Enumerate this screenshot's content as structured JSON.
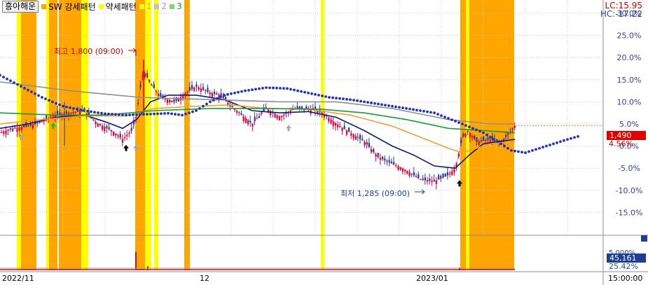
{
  "legend": {
    "title": "흥아해운",
    "strong_label": "SW 강세패턴",
    "weak_label": "약세패턴",
    "numbers": [
      "1",
      "2",
      "3"
    ]
  },
  "header_right": {
    "lc": "LC:15.95",
    "hc": "HC:-17.22"
  },
  "current": {
    "price": "1,490",
    "change_pct": "4.56%"
  },
  "annotations": {
    "high": "최고 1,800 (09:00)",
    "low": "최저 1,285 (09:00)"
  },
  "volume_panel": {
    "value": "45,161",
    "pct": "25.42%",
    "top_label": "5.000%"
  },
  "x_axis": {
    "labels": [
      "2022/11",
      "12",
      "2023/01"
    ],
    "corner_time": "15:00:00"
  },
  "colors": {
    "strong_band": "#ffa500",
    "weak_band": "#ffff00",
    "candle_up": "#e0003a",
    "candle_down": "#1f3fa8",
    "ma_dark_blue": "#0d1a7a",
    "ma_orange": "#f0a030",
    "ma_green": "#1a9a3a",
    "ma_gray": "#909090",
    "projection_dots": "#2030c0",
    "axis_text": "#3b3b9b"
  },
  "chart_data": {
    "type": "line",
    "title": "",
    "y_axis_unit": "%",
    "y_ticks": [
      "30.0%",
      "25.0%",
      "20.0%",
      "15.0%",
      "10.0%",
      "5.0%",
      "0.0%",
      "-5.0%",
      "-10.0%",
      "-15.0%"
    ],
    "ylim": [
      -20,
      33
    ],
    "x_range": [
      0,
      860
    ],
    "x_ticks": [
      {
        "label": "2022/11",
        "x": 0
      },
      {
        "label": "12",
        "x": 283
      },
      {
        "label": "2023/01",
        "x": 592
      }
    ],
    "grid": true,
    "series": [
      {
        "kind": "close",
        "values": [
          [
            0,
            3.0
          ],
          [
            20,
            4.0
          ],
          [
            40,
            4.5
          ],
          [
            60,
            5.5
          ],
          [
            80,
            7.0
          ],
          [
            100,
            7.5
          ],
          [
            120,
            8.0
          ],
          [
            140,
            5.0
          ],
          [
            160,
            3.5
          ],
          [
            175,
            1.5
          ],
          [
            188,
            3.5
          ],
          [
            195,
            7.0
          ],
          [
            200,
            13.0
          ],
          [
            205,
            17.0
          ],
          [
            215,
            14.0
          ],
          [
            230,
            11.0
          ],
          [
            250,
            10.0
          ],
          [
            265,
            12.0
          ],
          [
            280,
            13.5
          ],
          [
            300,
            12.0
          ],
          [
            315,
            11.5
          ],
          [
            330,
            9.0
          ],
          [
            345,
            7.0
          ],
          [
            360,
            5.0
          ],
          [
            380,
            8.5
          ],
          [
            400,
            6.5
          ],
          [
            420,
            8.5
          ],
          [
            440,
            8.5
          ],
          [
            460,
            7.5
          ],
          [
            480,
            5.0
          ],
          [
            500,
            3.0
          ],
          [
            520,
            1.0
          ],
          [
            540,
            -2.5
          ],
          [
            560,
            -4.0
          ],
          [
            580,
            -5.5
          ],
          [
            600,
            -7.5
          ],
          [
            620,
            -8.0
          ],
          [
            640,
            -6.5
          ],
          [
            650,
            -5.0
          ],
          [
            660,
            2.0
          ],
          [
            668,
            3.5
          ],
          [
            680,
            1.0
          ],
          [
            700,
            1.5
          ],
          [
            715,
            0.8
          ],
          [
            730,
            3.5
          ],
          [
            735,
            4.56
          ]
        ]
      },
      {
        "kind": "ma",
        "color": "ma_dark_blue",
        "values": [
          [
            0,
            4.0
          ],
          [
            40,
            5.0
          ],
          [
            80,
            6.5
          ],
          [
            120,
            7.0
          ],
          [
            150,
            5.5
          ],
          [
            175,
            4.0
          ],
          [
            195,
            6.0
          ],
          [
            215,
            10.0
          ],
          [
            240,
            11.5
          ],
          [
            280,
            11.5
          ],
          [
            320,
            10.5
          ],
          [
            360,
            8.0
          ],
          [
            400,
            7.5
          ],
          [
            440,
            7.8
          ],
          [
            480,
            6.5
          ],
          [
            520,
            3.5
          ],
          [
            560,
            0.0
          ],
          [
            590,
            -2.0
          ],
          [
            620,
            -4.5
          ],
          [
            650,
            -5.0
          ],
          [
            670,
            -2.0
          ],
          [
            690,
            0.5
          ],
          [
            710,
            1.0
          ],
          [
            735,
            1.5
          ]
        ]
      },
      {
        "kind": "ma",
        "color": "ma_orange",
        "values": [
          [
            0,
            5.0
          ],
          [
            60,
            6.0
          ],
          [
            120,
            6.8
          ],
          [
            180,
            6.8
          ],
          [
            220,
            8.5
          ],
          [
            280,
            9.0
          ],
          [
            330,
            9.3
          ],
          [
            380,
            8.5
          ],
          [
            440,
            8.3
          ],
          [
            500,
            7.0
          ],
          [
            560,
            4.5
          ],
          [
            600,
            2.0
          ],
          [
            640,
            -0.5
          ],
          [
            660,
            -1.5
          ],
          [
            700,
            0.5
          ],
          [
            735,
            1.0
          ]
        ]
      },
      {
        "kind": "ma",
        "color": "ma_green",
        "values": [
          [
            0,
            7.5
          ],
          [
            80,
            7.0
          ],
          [
            150,
            7.0
          ],
          [
            220,
            8.0
          ],
          [
            300,
            8.5
          ],
          [
            380,
            8.5
          ],
          [
            460,
            8.3
          ],
          [
            520,
            7.5
          ],
          [
            580,
            6.0
          ],
          [
            640,
            4.0
          ],
          [
            690,
            3.5
          ],
          [
            735,
            3.0
          ]
        ]
      },
      {
        "kind": "ma",
        "color": "ma_gray",
        "values": [
          [
            0,
            14.5
          ],
          [
            100,
            12.5
          ],
          [
            200,
            11.0
          ],
          [
            300,
            10.5
          ],
          [
            400,
            10.0
          ],
          [
            480,
            10.0
          ],
          [
            560,
            8.5
          ],
          [
            640,
            6.0
          ],
          [
            700,
            5.0
          ],
          [
            735,
            5.0
          ]
        ]
      },
      {
        "kind": "projection",
        "color": "projection_dots",
        "values": [
          [
            0,
            16.0
          ],
          [
            30,
            13.5
          ],
          [
            60,
            11.0
          ],
          [
            90,
            9.0
          ],
          [
            120,
            8.0
          ],
          [
            150,
            7.3
          ],
          [
            180,
            7.0
          ],
          [
            210,
            7.2
          ],
          [
            240,
            7.4
          ],
          [
            260,
            7.0
          ],
          [
            280,
            8.0
          ],
          [
            300,
            10.0
          ],
          [
            320,
            11.5
          ],
          [
            350,
            12.5
          ],
          [
            380,
            13.2
          ],
          [
            410,
            13.0
          ],
          [
            440,
            12.0
          ],
          [
            470,
            11.0
          ],
          [
            500,
            10.5
          ],
          [
            540,
            9.5
          ],
          [
            580,
            8.5
          ],
          [
            620,
            7.5
          ],
          [
            660,
            5.0
          ],
          [
            690,
            3.0
          ],
          [
            710,
            1.0
          ],
          [
            730,
            -1.0
          ],
          [
            750,
            -1.5
          ],
          [
            770,
            -0.5
          ],
          [
            790,
            0.5
          ],
          [
            810,
            1.5
          ],
          [
            828,
            2.3
          ]
        ]
      }
    ],
    "bands": [
      {
        "x0": 24,
        "x1": 30,
        "kind": "weak"
      },
      {
        "x0": 30,
        "x1": 52,
        "kind": "strong"
      },
      {
        "x0": 66,
        "x1": 70,
        "kind": "weak"
      },
      {
        "x0": 70,
        "x1": 82,
        "kind": "strong"
      },
      {
        "x0": 84,
        "x1": 116,
        "kind": "strong"
      },
      {
        "x0": 116,
        "x1": 126,
        "kind": "weak"
      },
      {
        "x0": 193,
        "x1": 207,
        "kind": "strong"
      },
      {
        "x0": 207,
        "x1": 216,
        "kind": "weak"
      },
      {
        "x0": 220,
        "x1": 226,
        "kind": "weak"
      },
      {
        "x0": 263,
        "x1": 271,
        "kind": "strong"
      },
      {
        "x0": 458,
        "x1": 463,
        "kind": "weak"
      },
      {
        "x0": 657,
        "x1": 665,
        "kind": "strong"
      },
      {
        "x0": 665,
        "x1": 670,
        "kind": "weak"
      },
      {
        "x0": 670,
        "x1": 734,
        "kind": "strong"
      }
    ],
    "markers": [
      {
        "x": 30,
        "y": 2.0,
        "kind": "gray-up"
      },
      {
        "x": 76,
        "y": 4.5,
        "kind": "green-up"
      },
      {
        "x": 180,
        "y": -0.5,
        "kind": "black-up"
      },
      {
        "x": 194,
        "y": -0.5,
        "kind": "gray-up"
      },
      {
        "x": 412,
        "y": 4.0,
        "kind": "gray-up"
      },
      {
        "x": 656,
        "y": -8.5,
        "kind": "black-up"
      }
    ],
    "volume_spikes": [
      [
        193,
        0.55
      ],
      [
        210,
        0.12
      ],
      [
        655,
        0.08
      ]
    ]
  }
}
